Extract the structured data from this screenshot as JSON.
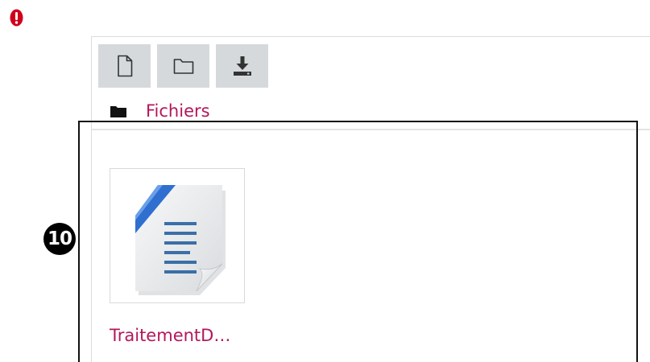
{
  "colors": {
    "link": "#b5165b",
    "toolbar_button_bg": "#d6d9dc",
    "error": "#d0021b",
    "annotation": "#000000"
  },
  "toolbar": {
    "buttons": [
      {
        "icon": "file-icon"
      },
      {
        "icon": "folder-icon"
      },
      {
        "icon": "download-icon"
      }
    ]
  },
  "path": {
    "icon": "folder-solid-icon",
    "label": "Fichiers"
  },
  "files": [
    {
      "name": "TraitementD…",
      "icon": "text-document-icon"
    }
  ],
  "annotation": {
    "step_number": "10"
  }
}
